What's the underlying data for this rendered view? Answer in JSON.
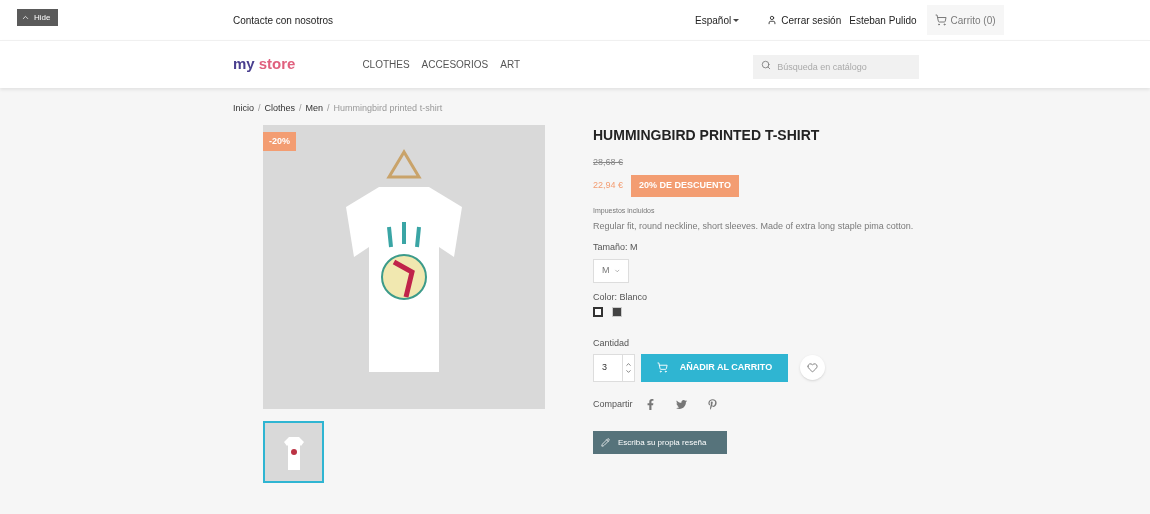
{
  "hide_button": {
    "label": "Hide"
  },
  "top_bar": {
    "contact": "Contacte con nosotros",
    "language": "Español",
    "logout": "Cerrar sesión",
    "user": "Esteban Pulido",
    "cart": "Carrito (0)"
  },
  "header": {
    "logo_parts": [
      {
        "text": "my",
        "color": "#4a3f8f"
      },
      {
        "text": "store",
        "color": "#e0607e"
      }
    ],
    "menu": [
      {
        "label": "CLOTHES"
      },
      {
        "label": "ACCESORIOS"
      },
      {
        "label": "ART"
      }
    ],
    "search": {
      "placeholder": "Búsqueda en catálogo"
    }
  },
  "breadcrumb": [
    {
      "label": "Inicio",
      "current": false
    },
    {
      "separator": "/",
      "label": "Clothes",
      "current": false
    },
    {
      "separator": "/",
      "label": "Men",
      "current": false
    },
    {
      "separator": "/",
      "label": "Hummingbird printed t-shirt",
      "current": true
    }
  ],
  "gallery": {
    "badge": "-20%",
    "thumbnails": [
      {
        "selected": true
      }
    ]
  },
  "product": {
    "title": "HUMMINGBIRD PRINTED T-SHIRT",
    "old_price": "28,68 €",
    "price": "22,94 €",
    "discount": "20% DE DESCUENTO",
    "tax_note": "Impuestos incluidos",
    "description": "Regular fit, round neckline, short sleeves. Made of extra long staple pima cotton.",
    "size_label": "Tamaño: M",
    "size_value": "M",
    "color_label": "Color: Blanco",
    "swatches": [
      {
        "color": "#ffffff",
        "selected": true
      },
      {
        "color": "#434343",
        "selected": false
      }
    ],
    "quantity_label": "Cantidad",
    "quantity": "3",
    "add_to_cart": "AÑADIR AL CARRITO",
    "share_label": "Compartir",
    "review_button": "Escriba su propia reseña"
  }
}
